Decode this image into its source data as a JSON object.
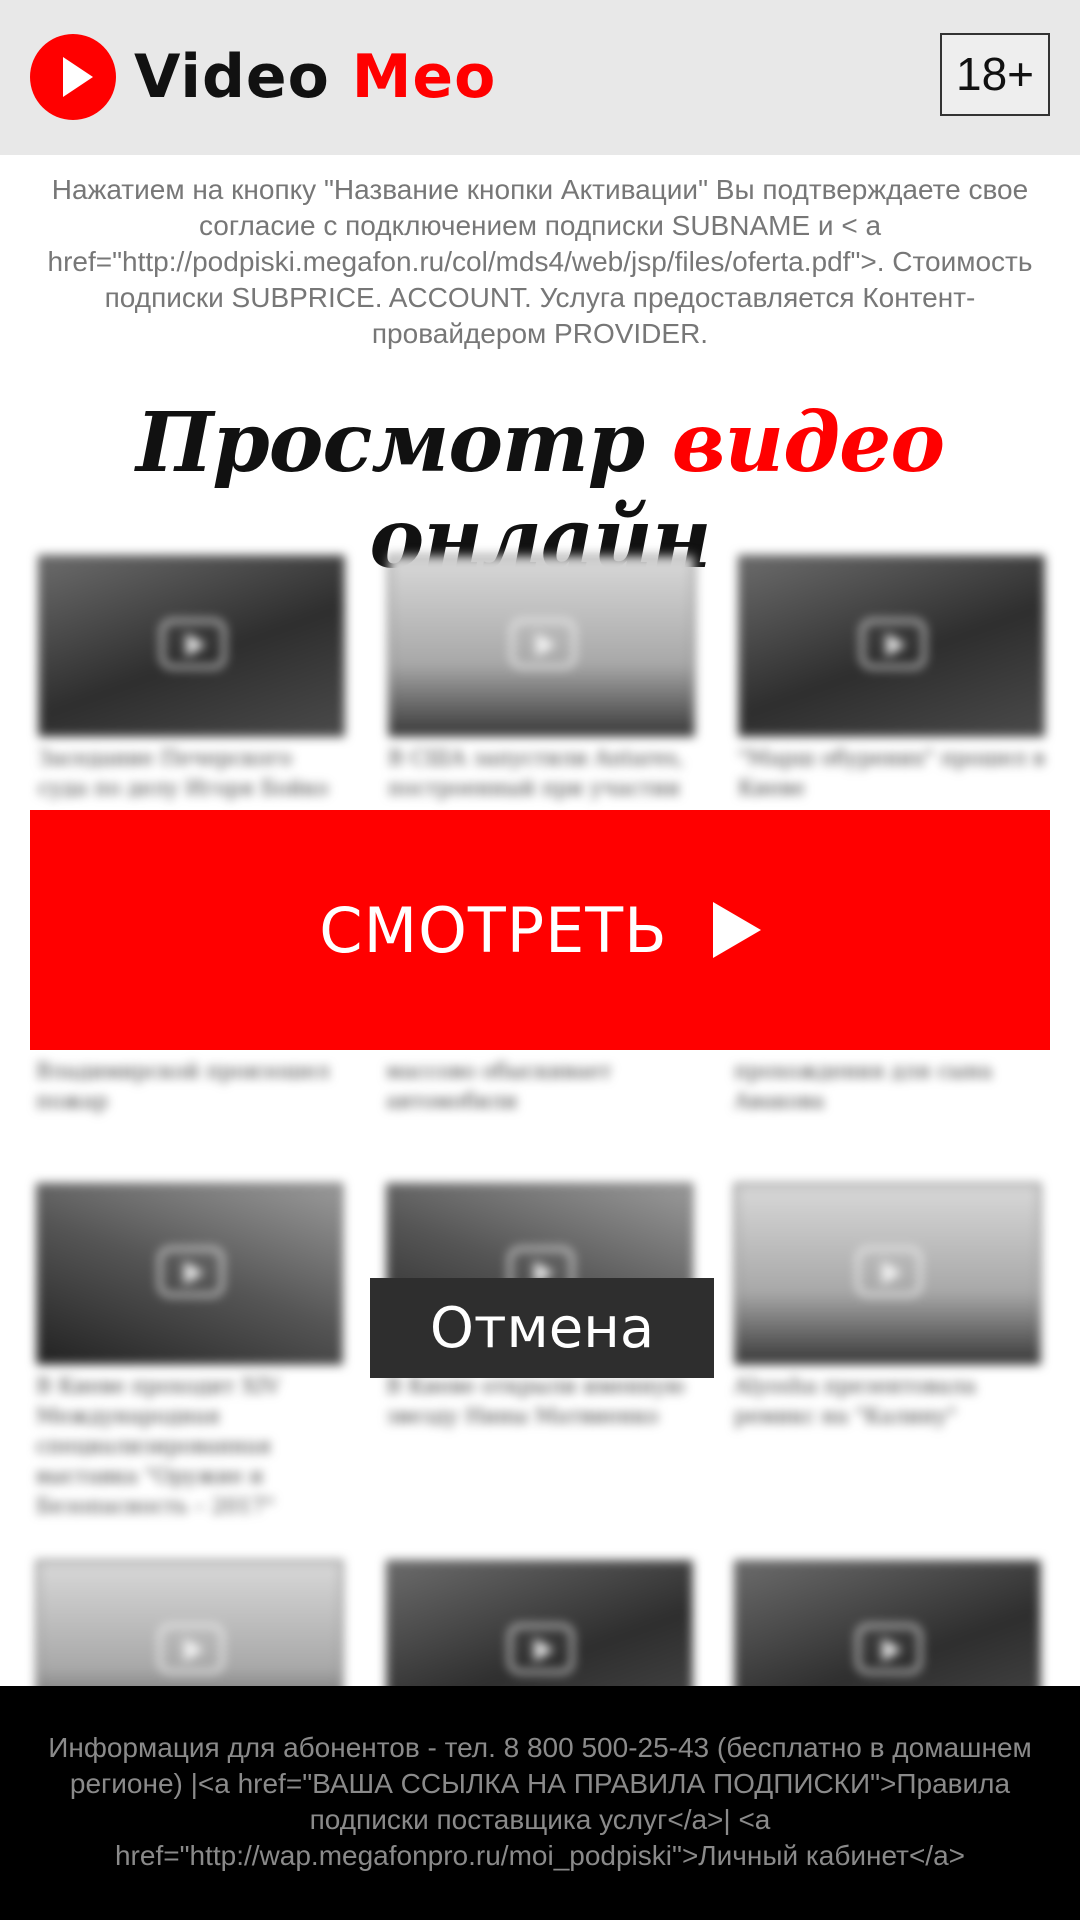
{
  "header": {
    "logo": {
      "word1": "Video",
      "word2": "Meo"
    },
    "age_rating": "18+"
  },
  "disclaimer": "Нажатием на кнопку \"Название кнопки Активации\" Вы подтверждаете свое согласие с подключением подписки SUBNAME и < a href=\"http://podpiski.megafon.ru/col/mds4/web/jsp/files/oferta.pdf\">. Стоимость подписки SUBPRICE. ACCOUNT. Услуга предоставляется Контент-провайдером PROVIDER.",
  "title": {
    "part1": "Просмотр ",
    "accent": "видео",
    "part2": " онлайн"
  },
  "videos": [
    {
      "caption": "Заседание Печерского суда по делу Игоря Бойко"
    },
    {
      "caption": "В США запустили Antares, построенный при участии"
    },
    {
      "caption": "\"Марш обурених\" прошел в Киеве"
    },
    {
      "caption": "Владимирской произошел пожар"
    },
    {
      "caption": "массово обыскивает автомобили"
    },
    {
      "caption": "прохождения для сына Авакова"
    },
    {
      "caption": "В Киеве проходит XIV Международная специализированная выставка \"Оружие и Безопасность – 2017\""
    },
    {
      "caption": "В Киеве открыли именную звезду Нины Матвиенко"
    },
    {
      "caption": "Alyosha презентовала ремикс на \"Калину\""
    },
    {
      "caption": ""
    },
    {
      "caption": ""
    },
    {
      "caption": ""
    }
  ],
  "cta": {
    "label": "СМОТРЕТЬ"
  },
  "cancel": {
    "label": "Отмена"
  },
  "footer": "Информация для абонентов - тел. 8 800 500-25-43 (бесплатно в домашнем регионе) |<a href=\"ВАША ССЫЛКА НА ПРАВИЛА ПОДПИСКИ\">Правила подписки поставщика услуг</a>| <a href=\"http://wap.megafonpro.ru/moi_podpiski\">Личный кабинет</a>"
}
